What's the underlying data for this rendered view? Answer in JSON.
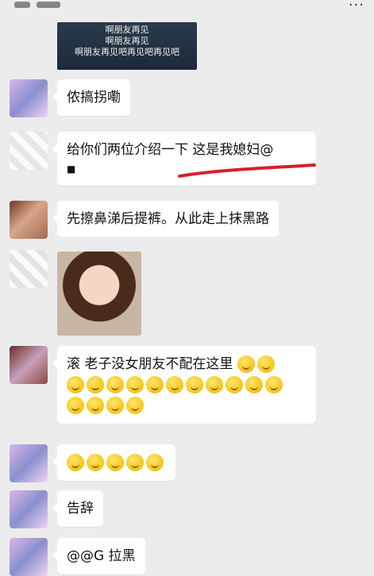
{
  "top_right_icon": "more-dots-icon",
  "video_card": {
    "lines": [
      "啊朋友再见",
      "啊朋友再见",
      "啊朋友再见吧再见吧再见吧"
    ]
  },
  "messages": [
    {
      "text": "侬搞拐嘞"
    },
    {
      "text_parts": [
        "给你们两位介绍一下  这是我媳妇@",
        "■"
      ]
    },
    {
      "text": "先擦鼻涕后提裤。从此走上抹黑路"
    },
    {
      "image": "sticker-little-girl"
    },
    {
      "text": "滚  老子没女朋友不配在这里"
    },
    {
      "emoji_count": 5
    },
    {
      "text": "告辞"
    },
    {
      "text": "@@G  拉黑"
    }
  ],
  "colors": {
    "background": "#ececec",
    "bubble": "#ffffff",
    "annotation_stroke": "#d81e2b"
  }
}
